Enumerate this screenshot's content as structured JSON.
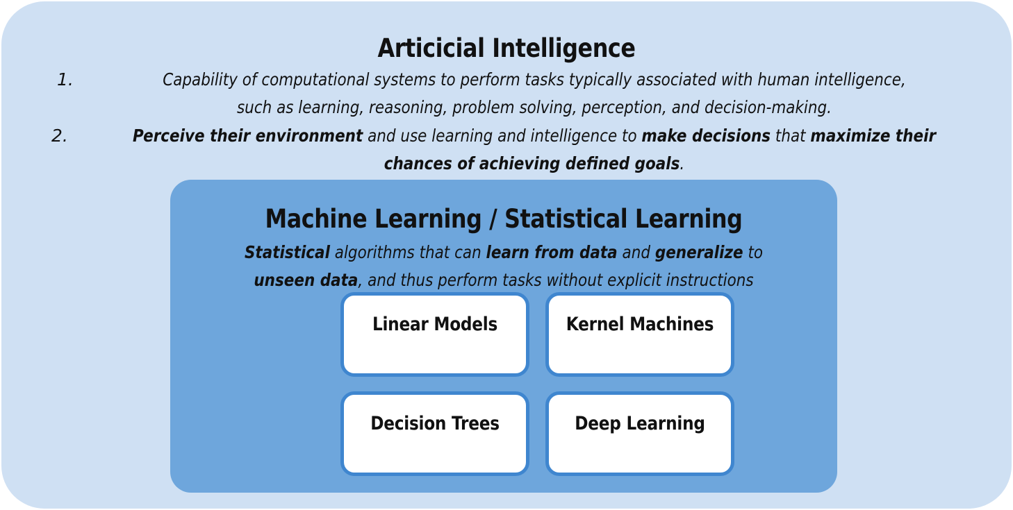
{
  "ai": {
    "title": "Articicial Intelligence",
    "item1": {
      "number": "1.",
      "line1": "Capability of computational systems to perform tasks typically associated with human intelligence,",
      "line2": "such as learning, reasoning, problem solving, perception, and decision-making."
    },
    "item2": {
      "number": "2.",
      "bold1": "Perceive their environment",
      "text1": " and use learning and intelligence to ",
      "bold2": "make decisions",
      "text2": " that ",
      "bold3": "maximize their",
      "bold4": "chances of achieving defined goals",
      "text3": "."
    }
  },
  "ml": {
    "title": "Machine Learning / Statistical Learning",
    "desc": {
      "bold1": "Statistical",
      "text1": " algorithms that can ",
      "bold2": "learn from data",
      "text2": " and ",
      "bold3": "generalize",
      "text3": " to",
      "bold4": "unseen data",
      "text4": ", and thus perform tasks without explicit instructions"
    }
  },
  "cards": {
    "linear_models": "Linear Models",
    "kernel_machines": "Kernel Machines",
    "decision_trees": "Decision Trees",
    "deep_learning": "Deep Learning"
  },
  "colors": {
    "outer_bg": "#cfe0f3",
    "ml_bg": "#6ea6dc",
    "card_border": "#3f86cf",
    "card_bg": "#ffffff"
  }
}
